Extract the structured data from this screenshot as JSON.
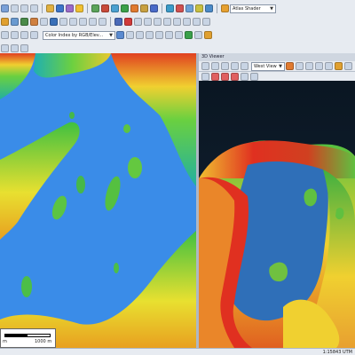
{
  "toolbar": {
    "shader_combo": "Atlas Shader",
    "color_combo": "Color Index by RGB/Elev...",
    "view_combo": "West View"
  },
  "viewer": {
    "title": "3D Viewer"
  },
  "scale": {
    "left": "m",
    "right": "1000 m"
  },
  "status": {
    "text": "1:15843   UTM"
  },
  "colors": {
    "water": "#3a8ce8",
    "terrain_low": "#33b24a",
    "terrain_mid": "#f0e040",
    "terrain_high": "#e03020",
    "panel": "#e7ebf1"
  }
}
